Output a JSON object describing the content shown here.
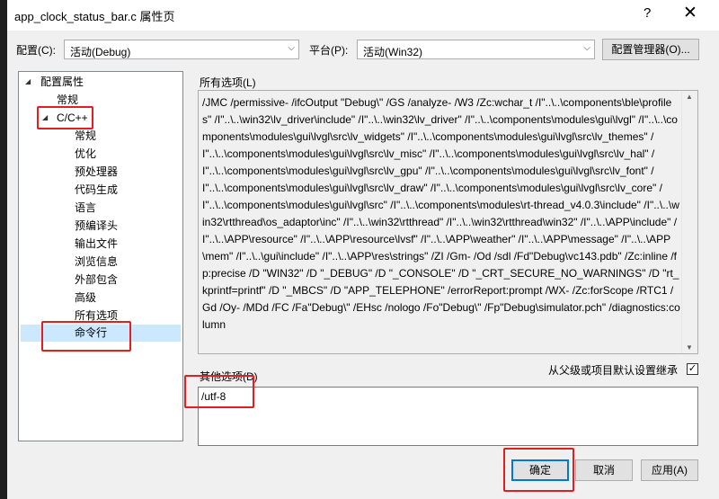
{
  "window": {
    "title": "app_clock_status_bar.c 属性页",
    "help_icon": "?",
    "close_icon": "✕"
  },
  "toolbar": {
    "config_label": "配置(C):",
    "config_value": "活动(Debug)",
    "platform_label": "平台(P):",
    "platform_value": "活动(Win32)",
    "config_manager_label": "配置管理器(O)..."
  },
  "tree": {
    "root": "配置属性",
    "items": [
      "常规",
      "C/C++",
      "常规",
      "优化",
      "预处理器",
      "代码生成",
      "语言",
      "预编译头",
      "输出文件",
      "浏览信息",
      "外部包含",
      "高级",
      "所有选项",
      "命令行"
    ],
    "selected": "命令行"
  },
  "all_options": {
    "label": "所有选项(L)",
    "text": "/JMC /permissive- /ifcOutput \"Debug\\\" /GS /analyze- /W3 /Zc:wchar_t /I\"..\\..\\components\\ble\\profiles\" /I\"..\\..\\win32\\lv_driver\\include\" /I\"..\\..\\win32\\lv_driver\" /I\"..\\..\\components\\modules\\gui\\lvgl\" /I\"..\\..\\components\\modules\\gui\\lvgl\\src\\lv_widgets\" /I\"..\\..\\components\\modules\\gui\\lvgl\\src\\lv_themes\" /I\"..\\..\\components\\modules\\gui\\lvgl\\src\\lv_misc\" /I\"..\\..\\components\\modules\\gui\\lvgl\\src\\lv_hal\" /I\"..\\..\\components\\modules\\gui\\lvgl\\src\\lv_gpu\" /I\"..\\..\\components\\modules\\gui\\lvgl\\src\\lv_font\" /I\"..\\..\\components\\modules\\gui\\lvgl\\src\\lv_draw\" /I\"..\\..\\components\\modules\\gui\\lvgl\\src\\lv_core\" /I\"..\\..\\components\\modules\\gui\\lvgl\\src\" /I\"..\\..\\components\\modules\\rt-thread_v4.0.3\\include\" /I\"..\\..\\win32\\rtthread\\os_adaptor\\inc\" /I\"..\\..\\win32\\rtthread\" /I\"..\\..\\win32\\rtthread\\win32\" /I\"..\\..\\APP\\include\" /I\"..\\..\\APP\\resource\" /I\"..\\..\\APP\\resource\\lvsf\" /I\"..\\..\\APP\\weather\" /I\"..\\..\\APP\\message\" /I\"..\\..\\APP\\mem\" /I\"..\\..\\gui\\include\" /I\"..\\..\\APP\\res\\strings\" /ZI /Gm- /Od /sdl /Fd\"Debug\\vc143.pdb\" /Zc:inline /fp:precise /D \"WIN32\" /D \"_DEBUG\" /D \"_CONSOLE\" /D \"_CRT_SECURE_NO_WARNINGS\" /D \"rt_kprintf=printf\" /D \"_MBCS\" /D \"APP_TELEPHONE\" /errorReport:prompt /WX- /Zc:forScope /RTC1 /Gd /Oy- /MDd /FC /Fa\"Debug\\\" /EHsc /nologo /Fo\"Debug\\\" /Fp\"Debug\\simulator.pch\" /diagnostics:column"
  },
  "other_options": {
    "label": "其他选项(D)",
    "value": "/utf-8",
    "inherit_label": "从父级或项目默认设置继承",
    "inherit_checked": "✓"
  },
  "buttons": {
    "ok": "确定",
    "cancel": "取消",
    "apply": "应用(A)"
  },
  "colors": {
    "highlight": "#e02020",
    "selection": "#cce8ff",
    "ok_border": "#0078d7"
  }
}
